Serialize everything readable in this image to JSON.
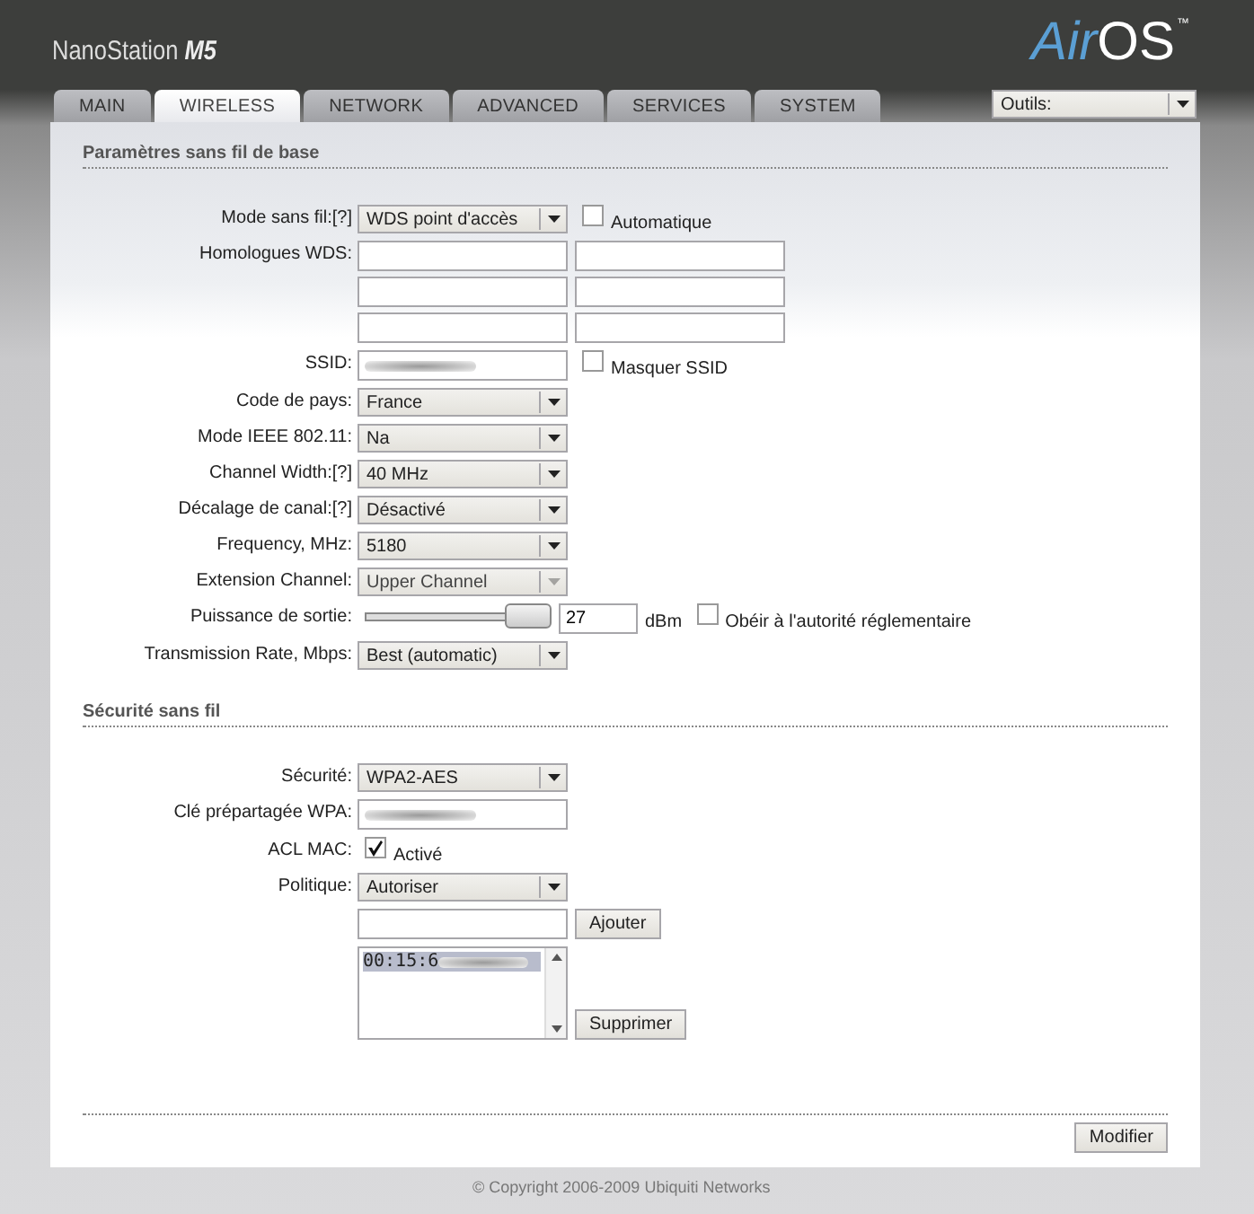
{
  "header": {
    "product": "NanoStation",
    "model": "M5",
    "logo_a": "Air",
    "logo_b": "OS",
    "trademark": "™",
    "tools": "Outils:"
  },
  "tabs": [
    {
      "label": "MAIN",
      "selected": false
    },
    {
      "label": "WIRELESS",
      "selected": true
    },
    {
      "label": "NETWORK",
      "selected": false
    },
    {
      "label": "ADVANCED",
      "selected": false
    },
    {
      "label": "SERVICES",
      "selected": false
    },
    {
      "label": "SYSTEM",
      "selected": false
    }
  ],
  "sections": [
    {
      "title": "Paramètres sans fil de base",
      "rows": [
        {
          "kind": "select",
          "label": "Mode sans fil:",
          "help": "[?]",
          "value": "WDS point d'accès",
          "disabled": false,
          "option": {
            "label": "Automatique",
            "checked": false
          }
        },
        {
          "kind": "peers",
          "label": "Homologues WDS:"
        },
        {
          "kind": "text",
          "label": "SSID:",
          "blurred": true,
          "option": {
            "label": "Masquer SSID",
            "checked": false
          }
        },
        {
          "kind": "select",
          "label": "Code de pays:",
          "value": "France",
          "disabled": false
        },
        {
          "kind": "select",
          "label": "Mode IEEE 802.11:",
          "value": "Na",
          "disabled": false
        },
        {
          "kind": "select",
          "label": "Channel Width:",
          "help": "[?]",
          "value": "40 MHz",
          "disabled": false
        },
        {
          "kind": "select",
          "label": "Décalage de canal:",
          "help": "[?]",
          "value": "Désactivé",
          "disabled": false
        },
        {
          "kind": "select",
          "label": "Frequency, MHz:",
          "value": "5180",
          "disabled": false
        },
        {
          "kind": "select",
          "label": "Extension Channel:",
          "value": "Upper Channel",
          "disabled": true
        },
        {
          "kind": "slider",
          "label": "Puissance de sortie:",
          "level": 1,
          "value": "27",
          "unit": "dBm",
          "option": {
            "label": "Obéir à l'autorité réglementaire",
            "checked": false
          }
        },
        {
          "kind": "select",
          "label": "Transmission Rate, Mbps:",
          "value": "Best (automatic)",
          "disabled": false
        }
      ]
    },
    {
      "title": "Sécurité sans fil",
      "rows": [
        {
          "kind": "select",
          "label": "Sécurité:",
          "value": "WPA2-AES",
          "disabled": false
        },
        {
          "kind": "text",
          "label": "Clé prépartagée WPA:",
          "blurred": true
        },
        {
          "kind": "checkbox",
          "label": "ACL MAC:",
          "option": {
            "label": "Activé",
            "checked": true
          }
        },
        {
          "kind": "select",
          "label": "Politique:",
          "value": "Autoriser",
          "disabled": false
        },
        {
          "kind": "add",
          "button": "Ajouter"
        },
        {
          "kind": "list",
          "items": [
            {
              "text": "00:15:6",
              "blurred": true,
              "selected": true
            }
          ],
          "button": "Supprimer"
        }
      ]
    }
  ],
  "submit": "Modifier",
  "footer": "© Copyright 2006-2009 Ubiquiti Networks"
}
